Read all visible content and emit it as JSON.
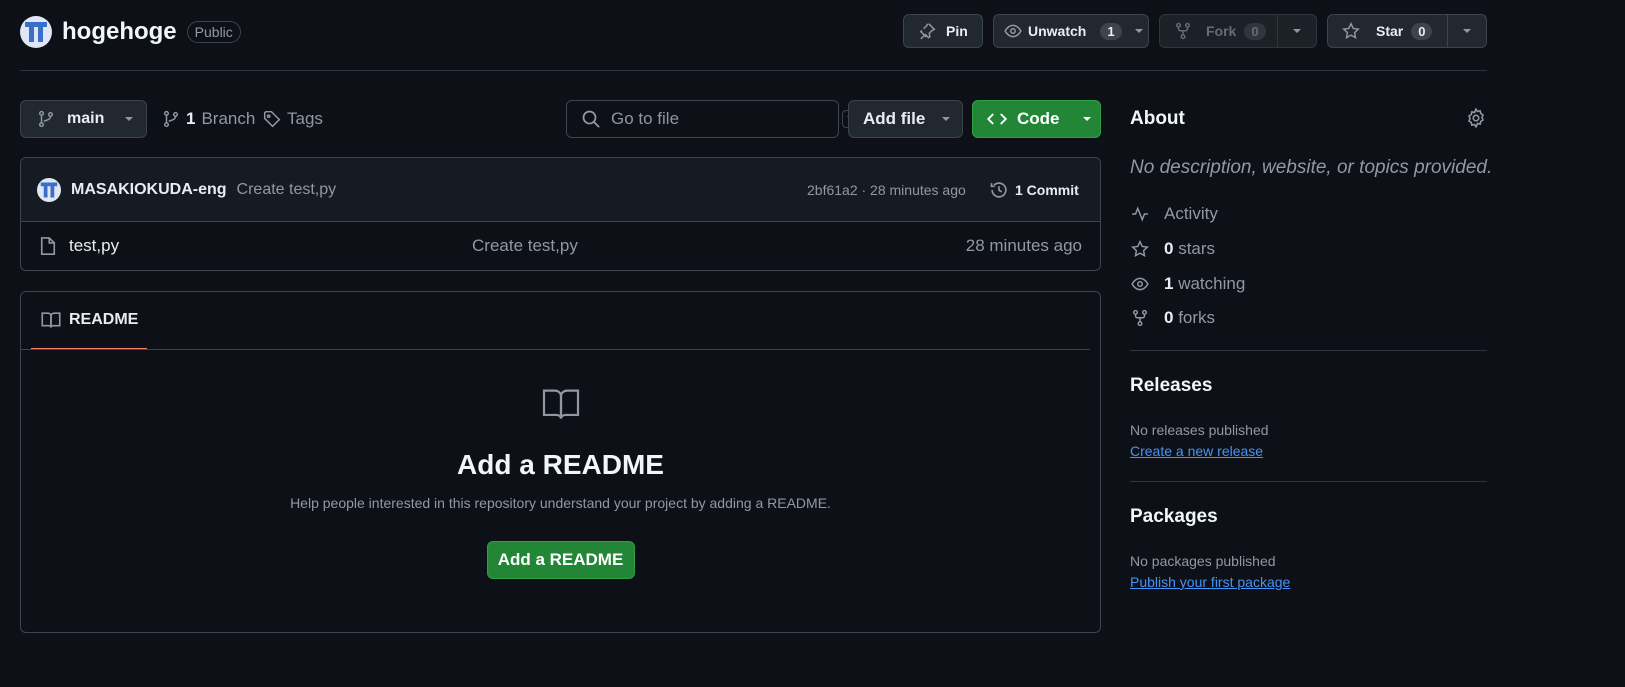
{
  "repo": {
    "name": "hogehoge",
    "visibility": "Public"
  },
  "actions": {
    "pin_label": "Pin",
    "unwatch_label": "Unwatch",
    "unwatch_count": "1",
    "fork_label": "Fork",
    "fork_count": "0",
    "star_label": "Star",
    "star_count": "0"
  },
  "toolbar": {
    "branch": "main",
    "branch_count": "1",
    "branch_label": "Branch",
    "tags_label": "Tags",
    "search_placeholder": "Go to file",
    "search_shortcut": "t",
    "add_file_label": "Add file",
    "code_label": "Code"
  },
  "latest_commit": {
    "author": "MASAKIOKUDA-eng",
    "message": "Create test,py",
    "hash_and_time": "2bf61a2 · 28 minutes ago",
    "commit_count_label": "1 Commit"
  },
  "files": [
    {
      "name": "test,py",
      "message": "Create test,py",
      "age": "28 minutes ago"
    }
  ],
  "readme": {
    "tab_label": "README",
    "title": "Add a README",
    "description": "Help people interested in this repository understand your project by adding a README.",
    "button_label": "Add a README"
  },
  "about": {
    "heading": "About",
    "description": "No description, website, or topics provided.",
    "activity_label": "Activity",
    "stars_count": "0",
    "stars_label": "stars",
    "watching_count": "1",
    "watching_label": "watching",
    "forks_count": "0",
    "forks_label": "forks"
  },
  "releases": {
    "heading": "Releases",
    "status": "No releases published",
    "link": "Create a new release"
  },
  "packages": {
    "heading": "Packages",
    "status": "No packages published",
    "link": "Publish your first package"
  },
  "colors": {
    "background": "#0d1117",
    "primary_green": "#238636",
    "link_blue": "#4493f8",
    "tab_underline": "#f78166"
  }
}
